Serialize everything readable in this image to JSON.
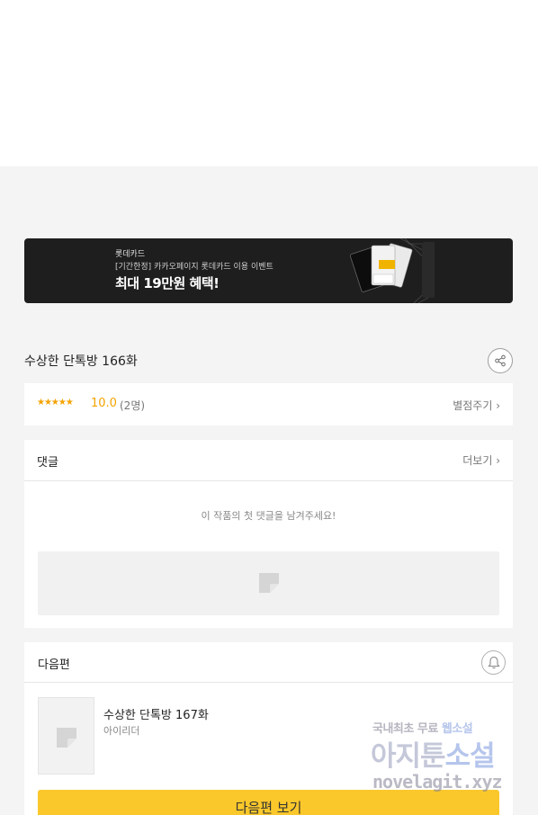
{
  "banner": {
    "brand": "롯데카드",
    "subtitle": "[기간한정] 카카오페이지 롯데카드 이용 이벤트",
    "headline": "최대 19만원 혜택!"
  },
  "episode": {
    "title": "수상한 단톡방 166화"
  },
  "rating": {
    "stars": "★★★★★",
    "score": "10.0",
    "count": "(2명)",
    "rate_label": "별점주기 ›"
  },
  "comments": {
    "title": "댓글",
    "more_label": "더보기 ›",
    "empty_message": "이 작품의 첫 댓글을 남겨주세요!"
  },
  "next_episode": {
    "section_title": "다음편",
    "title": "수상한 단톡방 167화",
    "author": "아이리더",
    "button_label": "다음편 보기"
  },
  "watermark": {
    "line1_a": "국내최초 무료 ",
    "line1_b": "웹소설",
    "line2_a": "아지툰",
    "line2_b": "소설",
    "line3": "novelagit.xyz"
  },
  "colors": {
    "accent": "#fbc82b",
    "star": "#f4a300",
    "banner_bg": "#1e1e1e"
  },
  "icons": {
    "share": "share-icon",
    "bell": "bell-icon",
    "placeholder": "image-placeholder-icon"
  }
}
